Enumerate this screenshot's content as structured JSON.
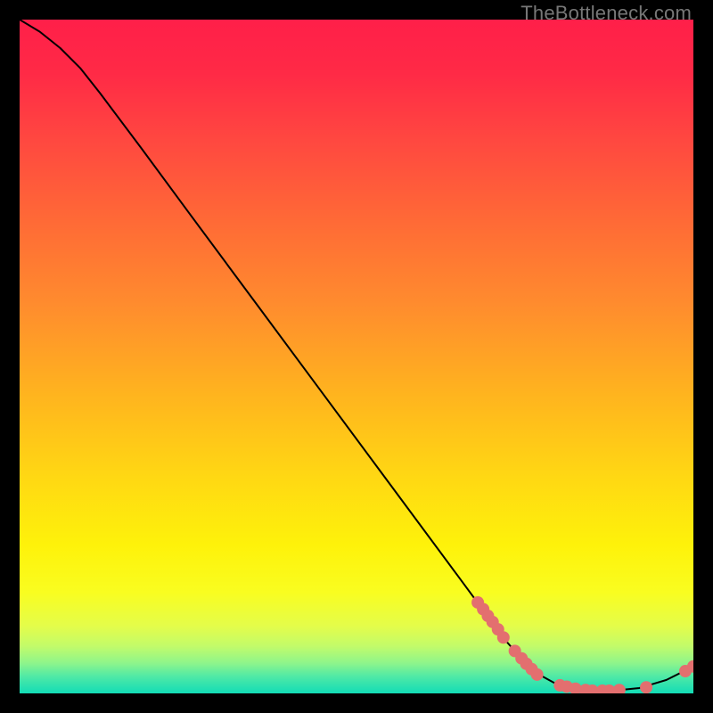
{
  "watermark": "TheBottleneck.com",
  "chart_data": {
    "type": "line",
    "title": "",
    "xlabel": "",
    "ylabel": "",
    "xlim": [
      0,
      100
    ],
    "ylim": [
      0,
      100
    ],
    "curve": [
      {
        "x": 0,
        "y": 100
      },
      {
        "x": 3,
        "y": 98.2
      },
      {
        "x": 6,
        "y": 95.8
      },
      {
        "x": 9,
        "y": 92.8
      },
      {
        "x": 12,
        "y": 89.0
      },
      {
        "x": 18,
        "y": 81.0
      },
      {
        "x": 25,
        "y": 71.5
      },
      {
        "x": 35,
        "y": 58.0
      },
      {
        "x": 45,
        "y": 44.5
      },
      {
        "x": 55,
        "y": 31.0
      },
      {
        "x": 65,
        "y": 17.5
      },
      {
        "x": 72,
        "y": 8.0
      },
      {
        "x": 76,
        "y": 3.4
      },
      {
        "x": 80,
        "y": 1.2
      },
      {
        "x": 84,
        "y": 0.4
      },
      {
        "x": 88,
        "y": 0.4
      },
      {
        "x": 92,
        "y": 0.8
      },
      {
        "x": 96,
        "y": 2.0
      },
      {
        "x": 100,
        "y": 4.0
      }
    ],
    "marker_points": [
      {
        "x": 68.0,
        "y": 13.5
      },
      {
        "x": 68.8,
        "y": 12.5
      },
      {
        "x": 69.5,
        "y": 11.5
      },
      {
        "x": 70.2,
        "y": 10.6
      },
      {
        "x": 71.0,
        "y": 9.5
      },
      {
        "x": 71.8,
        "y": 8.3
      },
      {
        "x": 73.5,
        "y": 6.3
      },
      {
        "x": 74.5,
        "y": 5.2
      },
      {
        "x": 75.2,
        "y": 4.4
      },
      {
        "x": 76.0,
        "y": 3.6
      },
      {
        "x": 76.8,
        "y": 2.8
      },
      {
        "x": 80.2,
        "y": 1.2
      },
      {
        "x": 81.2,
        "y": 1.0
      },
      {
        "x": 82.5,
        "y": 0.7
      },
      {
        "x": 84.0,
        "y": 0.5
      },
      {
        "x": 85.0,
        "y": 0.4
      },
      {
        "x": 86.5,
        "y": 0.4
      },
      {
        "x": 87.5,
        "y": 0.4
      },
      {
        "x": 89.0,
        "y": 0.5
      },
      {
        "x": 93.0,
        "y": 0.9
      },
      {
        "x": 98.8,
        "y": 3.3
      },
      {
        "x": 100.0,
        "y": 4.0
      }
    ],
    "marker_color": "#e36f6f",
    "marker_radius_px": 7,
    "line_color": "#000000"
  }
}
